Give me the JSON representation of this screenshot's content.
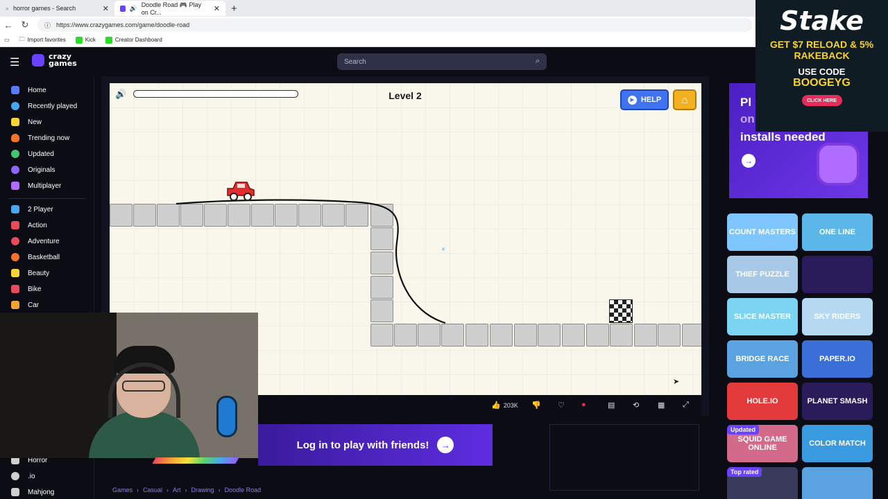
{
  "browser": {
    "tabs": [
      {
        "label": "horror games - Search"
      },
      {
        "label": "Doodle Road 🎮 Play on Cr..."
      }
    ],
    "url": "https://www.crazygames.com/game/doodle-road",
    "favorites": [
      {
        "label": "Import favorites"
      },
      {
        "label": "Kick"
      },
      {
        "label": "Creator Dashboard"
      }
    ]
  },
  "site": {
    "logo_line1": "crazy",
    "logo_line2": "games",
    "search_placeholder": "Search"
  },
  "sidebar": {
    "items": [
      {
        "label": "Home",
        "color": "#5b7bff"
      },
      {
        "label": "Recently played",
        "color": "#4aa6ef"
      },
      {
        "label": "New",
        "color": "#f7d335"
      },
      {
        "label": "Trending now",
        "color": "#f5742b"
      },
      {
        "label": "Updated",
        "color": "#41c774"
      },
      {
        "label": "Originals",
        "color": "#8f66ff"
      },
      {
        "label": "Multiplayer",
        "color": "#b06bff"
      },
      {
        "label": "2 Player",
        "color": "#4aa6ef"
      },
      {
        "label": "Action",
        "color": "#e94b5c"
      },
      {
        "label": "Adventure",
        "color": "#e94b5c"
      },
      {
        "label": "Basketball",
        "color": "#f5742b"
      },
      {
        "label": "Beauty",
        "color": "#f7d335"
      },
      {
        "label": "Bike",
        "color": "#e94b5c"
      },
      {
        "label": "Car",
        "color": "#f3a233"
      },
      {
        "label": "Horror",
        "color": "#cfcfcf"
      },
      {
        "label": ".io",
        "color": "#cfcfcf"
      },
      {
        "label": "Mahjong",
        "color": "#cfcfcf"
      }
    ]
  },
  "game": {
    "level_label": "Level 2",
    "help_label": "HELP",
    "progress": 0,
    "likes": "203K"
  },
  "login_banner": {
    "label": "Log in to play with friends!"
  },
  "breadcrumb": [
    "Games",
    "Casual",
    "Art",
    "Drawing",
    "Doodle Road"
  ],
  "ad": {
    "line1": "Pl",
    "line2": "on",
    "line3": "installs needed"
  },
  "thumbnails": [
    {
      "label": "COUNT MASTERS",
      "bg": "#7fc6ff"
    },
    {
      "label": "ONE LINE",
      "bg": "#5bb7e8"
    },
    {
      "label": "THIEF PUZZLE",
      "bg": "#a8c8e8"
    },
    {
      "label": "",
      "bg": "#2a1b5a"
    },
    {
      "label": "SLICE MASTER",
      "bg": "#7bd4f2"
    },
    {
      "label": "SKY RIDERS",
      "bg": "#b6d9f2"
    },
    {
      "label": "BRIDGE RACE",
      "bg": "#5aa3e0"
    },
    {
      "label": "PAPER.IO",
      "bg": "#3a6fd8"
    },
    {
      "label": "HOLE.IO",
      "bg": "#e33b3b"
    },
    {
      "label": "PLANET SMASH",
      "bg": "#2a1b5a"
    },
    {
      "label": "SQUID GAME ONLINE",
      "bg": "#d46a8a"
    },
    {
      "label": "COLOR MATCH",
      "bg": "#3a9ae0"
    },
    {
      "label": "",
      "bg": "#3a3a5a"
    },
    {
      "label": "",
      "bg": "#5aa3e0"
    }
  ],
  "thumb_badges": {
    "updated": "Updated",
    "top_rated": "Top rated"
  },
  "stake": {
    "logo": "Stake",
    "promo1": "GET $7 RELOAD & 5%",
    "promo2": "RAKEBACK",
    "code_label": "USE CODE",
    "code": "BOOGEYG",
    "cta": "CLICK HERE"
  }
}
